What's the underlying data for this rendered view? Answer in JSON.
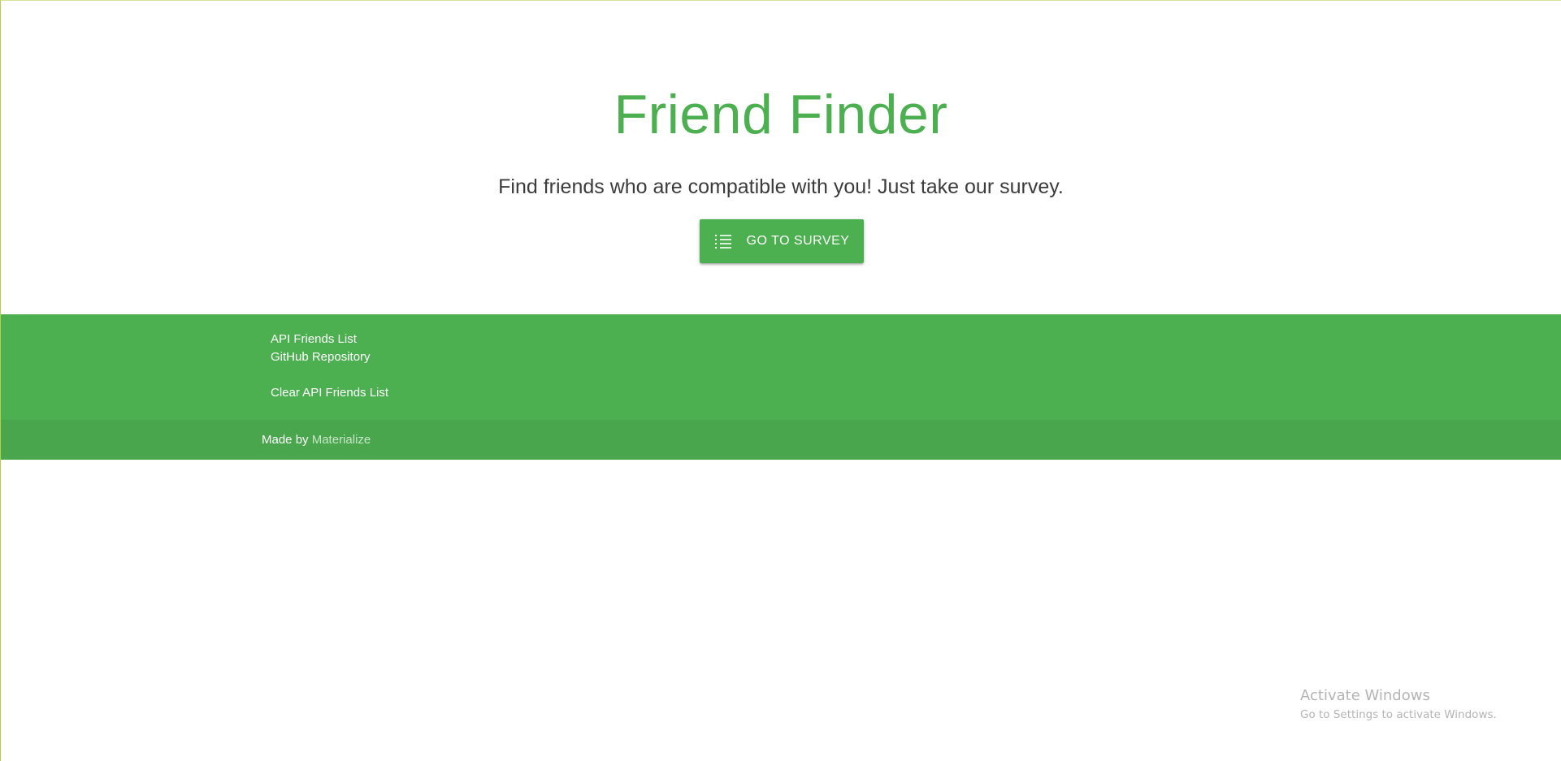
{
  "hero": {
    "title": "Friend Finder",
    "subtitle": "Find friends who are compatible with you! Just take our survey.",
    "button_label": "GO TO SURVEY",
    "button_icon": "list-icon"
  },
  "footer": {
    "links": [
      "API Friends List",
      "GitHub Repository",
      "Clear API Friends List"
    ],
    "made_by": "Made by",
    "made_by_link": "Materialize"
  },
  "watermark": {
    "title": "Activate Windows",
    "subtitle": "Go to Settings to activate Windows."
  },
  "colors": {
    "accent": "#4caf50",
    "footer_copyright_bg": "#49a64d",
    "link_light": "#c8e6c9"
  }
}
